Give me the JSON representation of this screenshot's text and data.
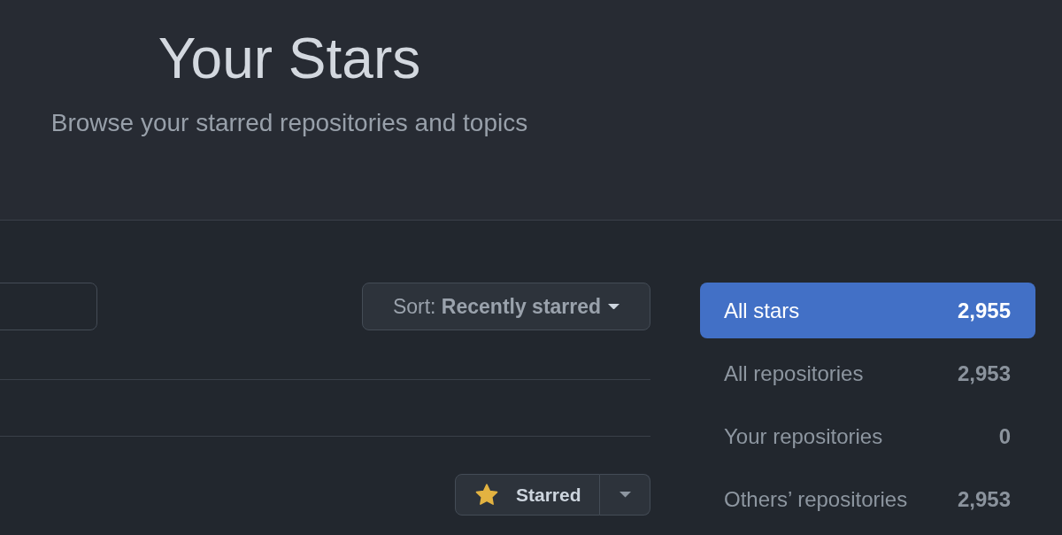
{
  "header": {
    "title": "Your Stars",
    "subtitle": "Browse your starred repositories and topics"
  },
  "toolbar": {
    "sort": {
      "label": "Sort: **Recently starred**"
    }
  },
  "repository": {
    "star_button": {
      "label": "Starred",
      "starred": true
    }
  },
  "filters": [
    {
      "label": "All stars",
      "count": "2,955",
      "selected": true
    },
    {
      "label": "All repositories",
      "count": "2,953",
      "selected": false
    },
    {
      "label": "Your repositories",
      "count": "0",
      "selected": false
    },
    {
      "label": "Others’ repositories",
      "count": "2,953",
      "selected": false
    }
  ]
}
